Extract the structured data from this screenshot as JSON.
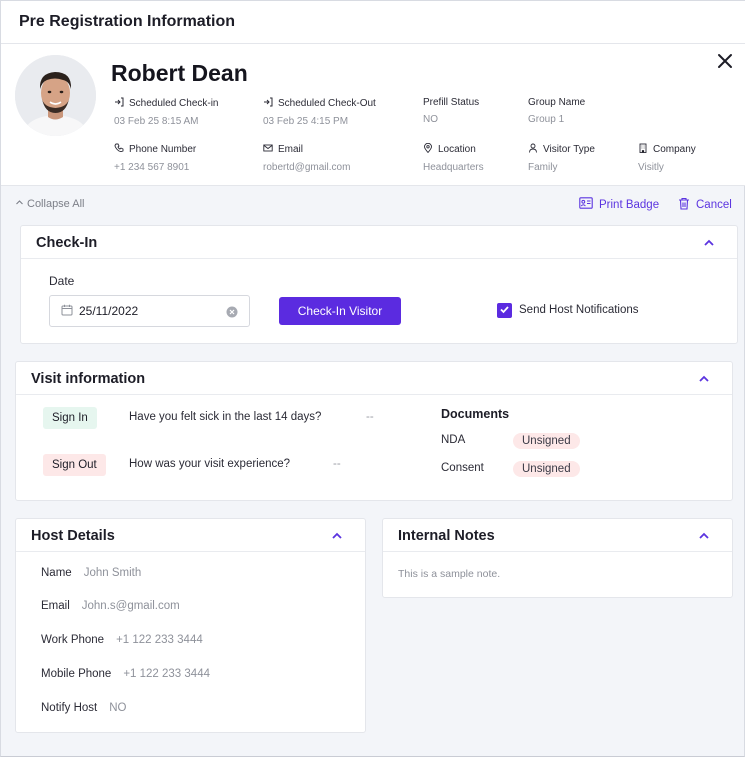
{
  "header": {
    "title": "Pre Registration Information"
  },
  "profile": {
    "name": "Robert Dean",
    "fields": [
      {
        "label": "Scheduled Check-in",
        "value": "03 Feb 25 8:15 AM",
        "icon": "login-arrow-icon"
      },
      {
        "label": "Scheduled Check-Out",
        "value": "03 Feb 25 4:15 PM",
        "icon": "login-arrow-icon"
      },
      {
        "label": "Prefill Status",
        "value": "NO",
        "icon": ""
      },
      {
        "label": "Group Name",
        "value": "Group 1",
        "icon": ""
      },
      {
        "label": "Phone Number",
        "value": "+1 234 567 8901",
        "icon": "phone-icon"
      },
      {
        "label": "Email",
        "value": "robertd@gmail.com",
        "icon": "mail-icon"
      },
      {
        "label": "Location",
        "value": "Headquarters",
        "icon": "location-pin-icon"
      },
      {
        "label": "Visitor Type",
        "value": "Family",
        "icon": "user-icon"
      },
      {
        "label": "Company",
        "value": "Visitly",
        "icon": "building-icon"
      }
    ]
  },
  "toolbar": {
    "collapse_all": "Collapse All",
    "print_badge": "Print Badge",
    "cancel": "Cancel"
  },
  "checkin": {
    "title": "Check-In",
    "date_label": "Date",
    "date_value": "25/11/2022",
    "button": "Check-In Visitor",
    "notify_label": "Send Host Notifications",
    "notify_checked": true
  },
  "visit": {
    "title": "Visit information",
    "rows": [
      {
        "tag": "Sign In",
        "question": "Have you felt sick in the last 14 days?",
        "answer": "--"
      },
      {
        "tag": "Sign Out",
        "question": "How was your visit experience?",
        "answer": "--"
      }
    ],
    "documents_title": "Documents",
    "documents": [
      {
        "name": "NDA",
        "status": "Unsigned"
      },
      {
        "name": "Consent",
        "status": "Unsigned"
      }
    ]
  },
  "host": {
    "title": "Host Details",
    "rows": [
      {
        "key": "Name",
        "value": "John Smith"
      },
      {
        "key": "Email",
        "value": "John.s@gmail.com"
      },
      {
        "key": "Work Phone",
        "value": "+1 122 233 3444"
      },
      {
        "key": "Mobile Phone",
        "value": "+1 122 233 3444"
      },
      {
        "key": "Notify Host",
        "value": "NO"
      }
    ]
  },
  "notes": {
    "title": "Internal Notes",
    "text": "This is a sample note."
  },
  "colors": {
    "accent": "#5b2be0",
    "success_bg": "#e6f6ef",
    "danger_bg": "#fde8e8"
  }
}
